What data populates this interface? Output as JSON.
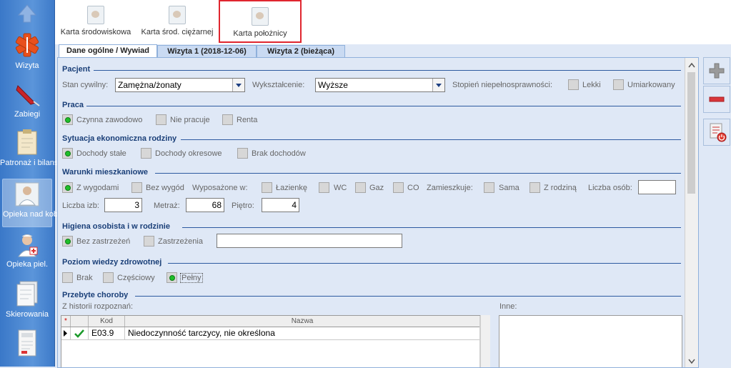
{
  "sidebar": {
    "items": [
      {
        "label": "",
        "icon": "up-arrow-icon"
      },
      {
        "label": "Wizyta",
        "icon": "medical-star-icon"
      },
      {
        "label": "Zabiegi",
        "icon": "syringe-icon"
      },
      {
        "label": "Patronaż i bilanse",
        "icon": "clipboard-icon"
      },
      {
        "label": "Opieka nad kobietą",
        "icon": "woman-doctor-icon"
      },
      {
        "label": "Opieka piel.",
        "icon": "nurse-icon"
      },
      {
        "label": "Skierowania",
        "icon": "documents-icon"
      },
      {
        "label": "",
        "icon": "prescription-icon"
      }
    ]
  },
  "toolbar": {
    "buttons": [
      {
        "label": "Karta środowiskowa"
      },
      {
        "label": "Karta środ. ciężarnej"
      },
      {
        "label": "Karta położnicy"
      }
    ]
  },
  "tabs": [
    {
      "label": "Dane ogólne / Wywiad"
    },
    {
      "label": "Wizyta 1 (2018-12-06)"
    },
    {
      "label": "Wizyta 2 (bieżąca)"
    }
  ],
  "pacjent": {
    "title": "Pacjent",
    "stan_label": "Stan cywilny:",
    "stan_value": "Zamężna/żonaty",
    "wyksz_label": "Wykształcenie:",
    "wyksz_value": "Wyższe",
    "stopien_label": "Stopień niepełnosprawności:",
    "lekki": "Lekki",
    "umiarkowany": "Umiarkowany"
  },
  "praca": {
    "title": "Praca",
    "options": [
      "Czynna zawodowo",
      "Nie pracuje",
      "Renta"
    ],
    "checked": 0
  },
  "sytuacja": {
    "title": "Sytuacja ekonomiczna rodziny",
    "options": [
      "Dochody stałe",
      "Dochody okresowe",
      "Brak dochodów"
    ],
    "checked": 0
  },
  "warunki": {
    "title": "Warunki mieszkaniowe",
    "z_wygodami": "Z wygodami",
    "bez_wygod": "Bez wygód",
    "wyposazone": "Wyposażone w:",
    "lazienke": "Łazienkę",
    "wc": "WC",
    "gaz": "Gaz",
    "co": "CO",
    "zamieszkuje": "Zamieszkuje:",
    "sama": "Sama",
    "z_rodzina": "Z rodziną",
    "liczba_osob": "Liczba osób:",
    "liczba_osob_value": "",
    "liczba_izb": "Liczba izb:",
    "liczba_izb_value": "3",
    "metraz": "Metraż:",
    "metraz_value": "68",
    "pietro": "Piętro:",
    "pietro_value": "4"
  },
  "higiena": {
    "title": "Higiena osobista i w rodzinie",
    "bez": "Bez zastrzeżeń",
    "zastrzezenia": "Zastrzeżenia",
    "zastrzezenia_value": ""
  },
  "wiedza": {
    "title": "Poziom wiedzy zdrowotnej",
    "options": [
      "Brak",
      "Częściowy",
      "Pełny"
    ],
    "checked": 2
  },
  "choroby": {
    "title": "Przebyte choroby",
    "z_historii": "Z historii rozpoznań:",
    "inne": "Inne:",
    "columns": {
      "star": "*",
      "kod": "Kod",
      "nazwa": "Nazwa"
    },
    "rows": [
      {
        "kod": "E03.9",
        "nazwa": "Niedoczynność tarczycy, nie określona"
      }
    ]
  },
  "colors": {
    "accent": "#2d5aa0",
    "selected_border": "#e0262f",
    "checked": "#1fbf2a"
  }
}
